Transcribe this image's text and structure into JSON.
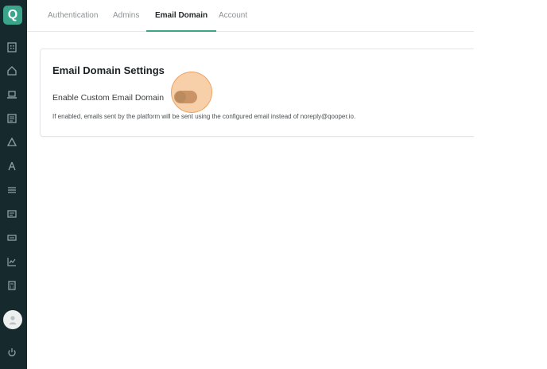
{
  "sidebar": {
    "logo_letter": "Q",
    "icons": [
      "building-icon",
      "home-icon",
      "laptop-icon",
      "clipboard-icon",
      "recycle-icon",
      "compass-icon",
      "list-icon",
      "card-icon",
      "id-card-icon",
      "line-chart-icon",
      "calculator-icon"
    ],
    "bottom_icon": "power-icon",
    "avatar": "user-avatar"
  },
  "tabs": [
    {
      "label": "Authentication"
    },
    {
      "label": "Admins"
    },
    {
      "label": "Email Domain",
      "active": true
    },
    {
      "label": "Account"
    }
  ],
  "card": {
    "title": "Email Domain Settings",
    "toggle_label": "Enable Custom Email Domain",
    "toggle_state": "off",
    "help_text": "If enabled, emails sent by the platform will be sent using the configured email instead of noreply@qooper.io."
  },
  "colors": {
    "sidebar_bg": "#16292c",
    "accent": "#3aa58a",
    "click_highlight": "#f0aa64"
  }
}
